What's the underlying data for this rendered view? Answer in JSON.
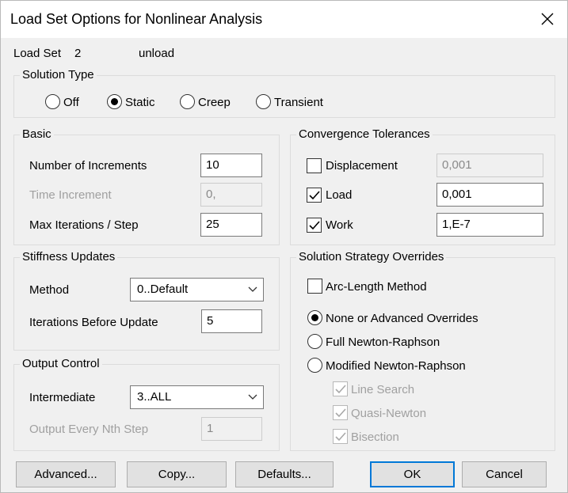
{
  "window": {
    "title": "Load Set Options for Nonlinear Analysis"
  },
  "load_set": {
    "label": "Load Set",
    "number": "2",
    "name": "unload"
  },
  "solution_type": {
    "title": "Solution Type",
    "options": [
      "Off",
      "Static",
      "Creep",
      "Transient"
    ],
    "selected": "Static"
  },
  "basic": {
    "title": "Basic",
    "num_increments_label": "Number of Increments",
    "num_increments_value": "10",
    "time_increment_label": "Time Increment",
    "time_increment_value": "0,",
    "max_iterations_label": "Max Iterations / Step",
    "max_iterations_value": "25"
  },
  "convergence": {
    "title": "Convergence Tolerances",
    "displacement_label": "Displacement",
    "displacement_value": "0,001",
    "displacement_checked": false,
    "load_label": "Load",
    "load_value": "0,001",
    "load_checked": true,
    "work_label": "Work",
    "work_value": "1,E-7",
    "work_checked": true
  },
  "stiffness": {
    "title": "Stiffness Updates",
    "method_label": "Method",
    "method_value": "0..Default",
    "iterations_label": "Iterations Before Update",
    "iterations_value": "5"
  },
  "strategy": {
    "title": "Solution Strategy Overrides",
    "arc_length_label": "Arc-Length Method",
    "none_label": "None or Advanced Overrides",
    "full_newton_label": "Full Newton-Raphson",
    "modified_newton_label": "Modified Newton-Raphson",
    "selected": "None or Advanced Overrides",
    "line_search_label": "Line Search",
    "quasi_newton_label": "Quasi-Newton",
    "bisection_label": "Bisection"
  },
  "output": {
    "title": "Output Control",
    "intermediate_label": "Intermediate",
    "intermediate_value": "3..ALL",
    "nth_step_label": "Output Every Nth Step",
    "nth_step_value": "1"
  },
  "buttons": {
    "advanced": "Advanced...",
    "copy": "Copy...",
    "defaults": "Defaults...",
    "ok": "OK",
    "cancel": "Cancel"
  },
  "icons": {
    "close": "close-icon",
    "dropdown": "chevron-down-icon",
    "check": "checkmark-icon"
  }
}
